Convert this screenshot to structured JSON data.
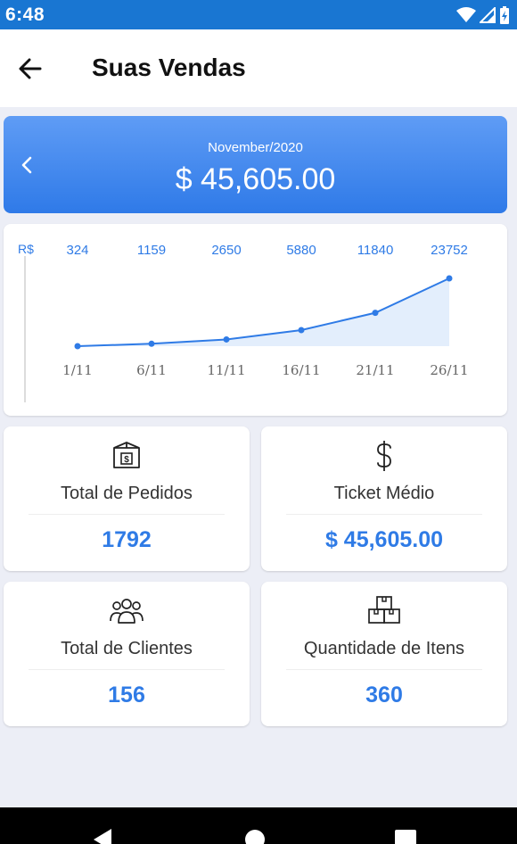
{
  "status": {
    "time": "6:48"
  },
  "appbar": {
    "title": "Suas Vendas"
  },
  "banner": {
    "period": "November/2020",
    "total": "$ 45,605.00"
  },
  "chart_data": {
    "type": "area",
    "y_unit_label": "R$",
    "x": [
      "1/11",
      "6/11",
      "11/11",
      "16/11",
      "21/11",
      "26/11"
    ],
    "values": [
      324,
      1159,
      2650,
      5880,
      11840,
      23752
    ],
    "data_labels": [
      "324",
      "1159",
      "2650",
      "5880",
      "11840",
      "23752"
    ],
    "ylim": [
      0,
      23752
    ],
    "line_color": "#2f7be6",
    "fill_color": "#e3eefc"
  },
  "stats": [
    {
      "icon": "box-dollar-icon",
      "label": "Total de Pedidos",
      "value": "1792"
    },
    {
      "icon": "dollar-icon",
      "label": "Ticket Médio",
      "value": "$ 45,605.00"
    },
    {
      "icon": "users-icon",
      "label": "Total de Clientes",
      "value": "156"
    },
    {
      "icon": "boxes-icon",
      "label": "Quantidade de Itens",
      "value": "360"
    }
  ],
  "colors": {
    "statusbar": "#1976d2",
    "accent": "#2f7be6",
    "background": "#eceef6"
  }
}
